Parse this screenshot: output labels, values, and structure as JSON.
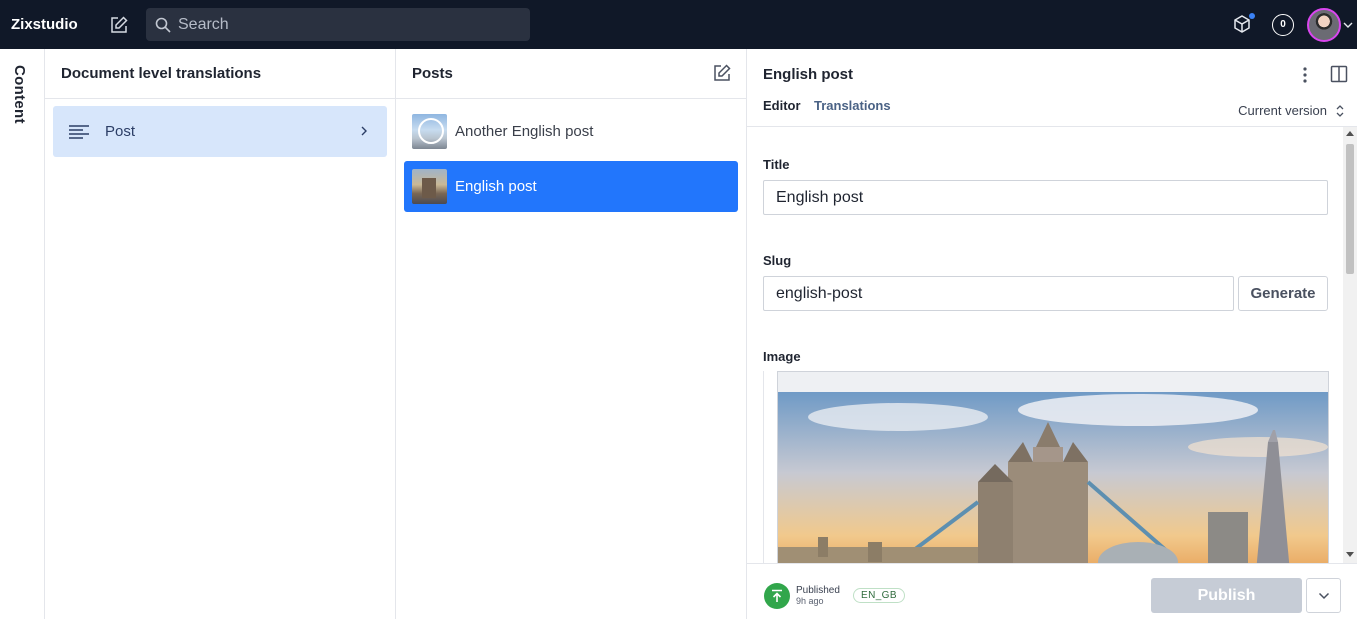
{
  "topbar": {
    "brand": "Zixstudio",
    "search_placeholder": "Search",
    "notification_count": "0"
  },
  "rail": {
    "label": "Content"
  },
  "types_pane": {
    "title": "Document level translations",
    "items": [
      {
        "label": "Post"
      }
    ]
  },
  "docs_pane": {
    "title": "Posts",
    "items": [
      {
        "label": "Another English post",
        "selected": false
      },
      {
        "label": "English post",
        "selected": true
      }
    ]
  },
  "editor": {
    "title": "English post",
    "tabs": {
      "editor": "Editor",
      "translations": "Translations"
    },
    "version": "Current version",
    "fields": {
      "title_label": "Title",
      "title_value": "English post",
      "slug_label": "Slug",
      "slug_value": "english-post",
      "generate_label": "Generate",
      "image_label": "Image"
    },
    "footer": {
      "status": "Published",
      "time": "9h ago",
      "language": "EN_GB",
      "publish_label": "Publish"
    }
  },
  "colors": {
    "topbar_bg": "#101828",
    "selected_row": "#2276fc",
    "type_highlight": "#d7e6fb",
    "published_green": "#31a64b",
    "publish_disabled": "#c6ccd6"
  }
}
